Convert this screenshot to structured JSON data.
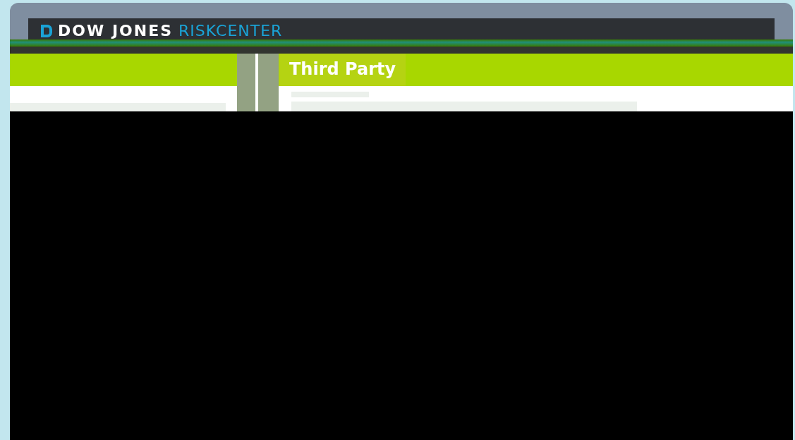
{
  "header": {
    "brand": "DOW JONES",
    "product": "RISKCENTER"
  },
  "tabs": [
    {
      "label": "Third Party",
      "selected": true
    }
  ]
}
